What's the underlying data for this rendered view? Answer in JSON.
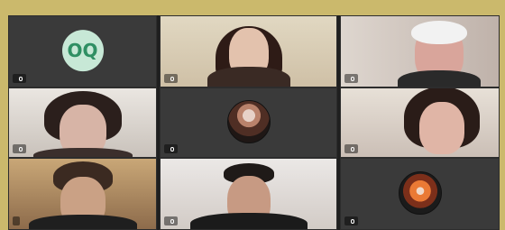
{
  "colors": {
    "frame": "#cbb96c",
    "background": "#1f1f1f",
    "tile_dark": "#3a3a3a",
    "avatar_bg": "#c7e8d6",
    "avatar_text": "#2f8f63"
  },
  "tiles": [
    {
      "kind": "initials",
      "initials": "OQ",
      "name": ""
    },
    {
      "kind": "video",
      "name": "",
      "muted": true
    },
    {
      "kind": "video",
      "name": "",
      "muted": true
    },
    {
      "kind": "video",
      "name": "",
      "muted": true
    },
    {
      "kind": "photo",
      "name": "",
      "muted": true
    },
    {
      "kind": "video",
      "name": "",
      "muted": true
    },
    {
      "kind": "video",
      "name": "",
      "muted": false
    },
    {
      "kind": "video",
      "name": "",
      "muted": true
    },
    {
      "kind": "photo",
      "name": "",
      "muted": true
    }
  ]
}
